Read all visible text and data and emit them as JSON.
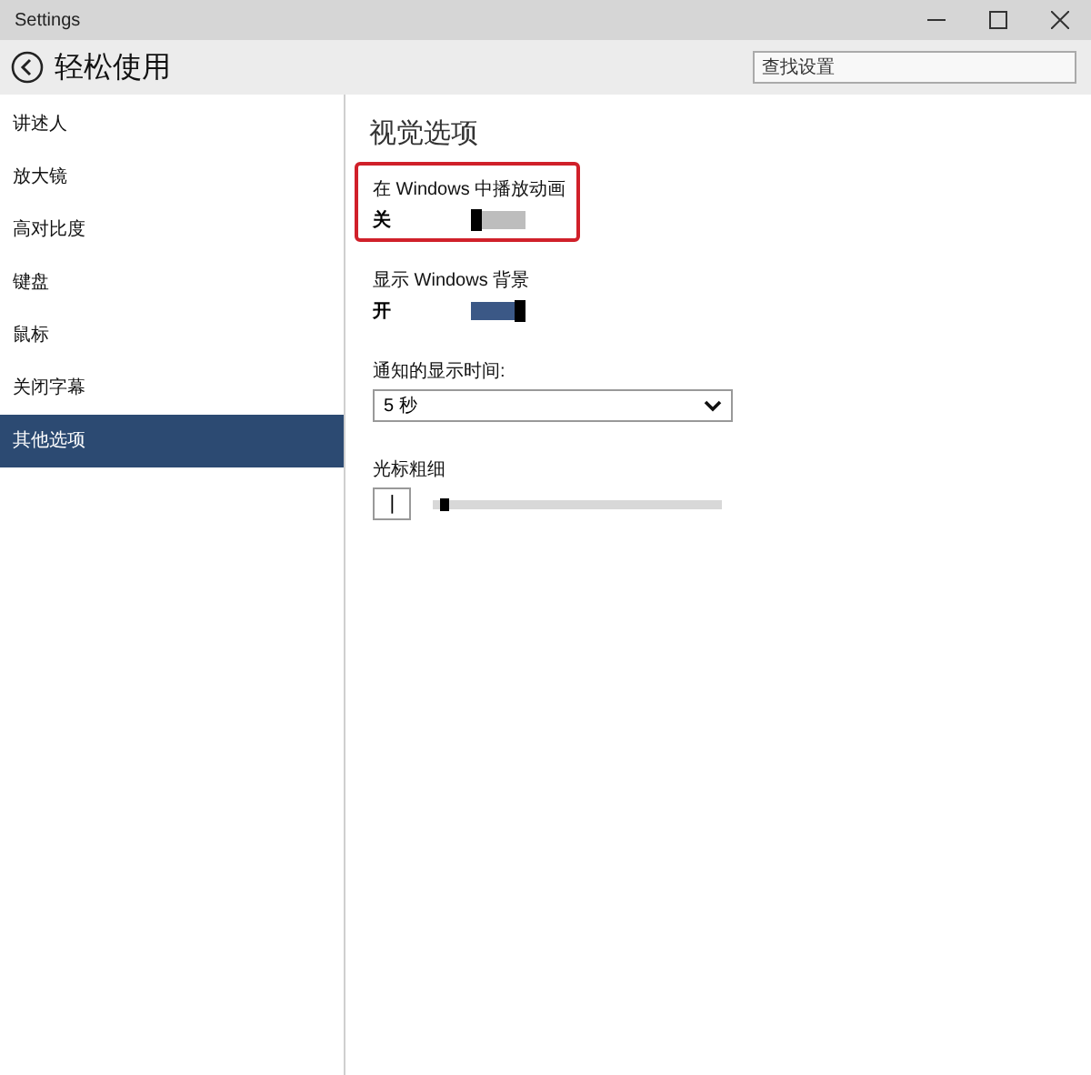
{
  "window": {
    "title": "Settings"
  },
  "header": {
    "title": "轻松使用",
    "search": {
      "placeholder": "查找设置"
    }
  },
  "sidebar": {
    "items": [
      {
        "label": "讲述人",
        "selected": false
      },
      {
        "label": "放大镜",
        "selected": false
      },
      {
        "label": "高对比度",
        "selected": false
      },
      {
        "label": "键盘",
        "selected": false
      },
      {
        "label": "鼠标",
        "selected": false
      },
      {
        "label": "关闭字幕",
        "selected": false
      },
      {
        "label": "其他选项",
        "selected": true
      }
    ]
  },
  "content": {
    "heading": "视觉选项",
    "settings": [
      {
        "kind": "toggle",
        "label": "在 Windows 中播放动画",
        "state_text": "关",
        "on": false,
        "highlighted": true
      },
      {
        "kind": "toggle",
        "label": "显示 Windows 背景",
        "state_text": "开",
        "on": true,
        "highlighted": false
      },
      {
        "kind": "dropdown",
        "label": "通知的显示时间:",
        "value": "5 秒"
      },
      {
        "kind": "slider",
        "label": "光标粗细",
        "preview": "|",
        "level": 0.02
      }
    ]
  }
}
